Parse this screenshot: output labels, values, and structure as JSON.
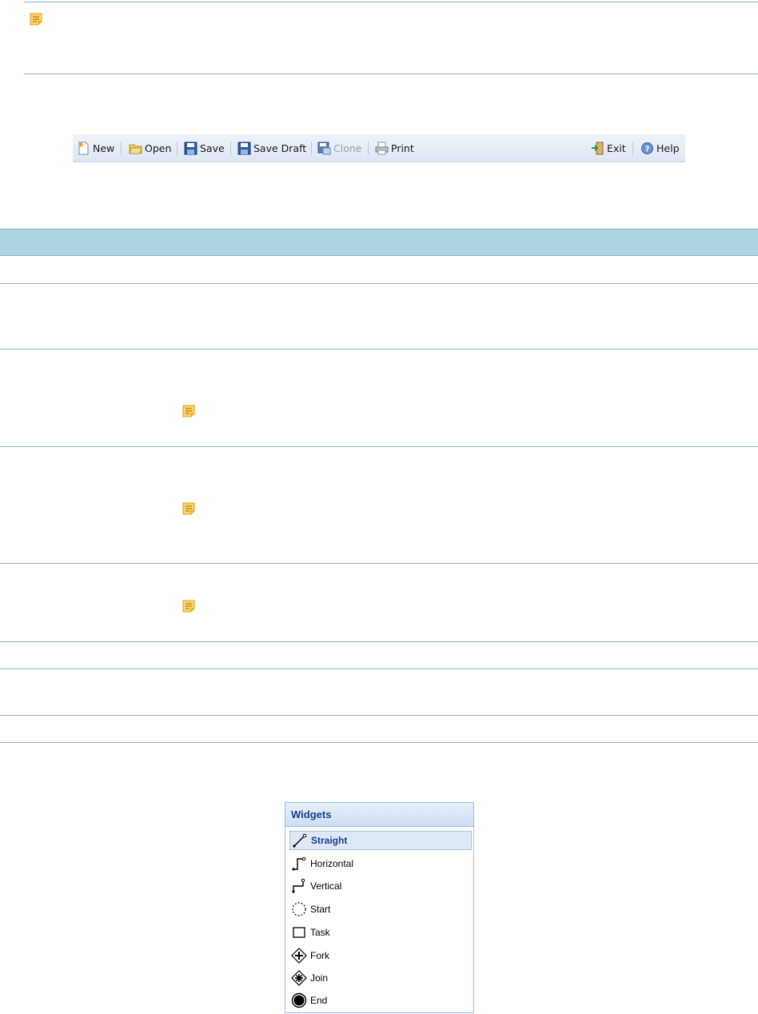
{
  "toolbar": {
    "new": "New",
    "open": "Open",
    "save": "Save",
    "save_draft": "Save Draft",
    "clone": "Clone",
    "print": "Print",
    "exit": "Exit",
    "help": "Help"
  },
  "widgets": {
    "title": "Widgets",
    "items": [
      {
        "label": "Straight",
        "icon": "straight-line-icon",
        "selected": true
      },
      {
        "label": "Horizontal",
        "icon": "horizontal-connector-icon"
      },
      {
        "label": "Vertical",
        "icon": "vertical-connector-icon"
      },
      {
        "label": "Start",
        "icon": "dashed-circle-icon"
      },
      {
        "label": "Task",
        "icon": "square-icon"
      },
      {
        "label": "Fork",
        "icon": "fork-diamond-icon"
      },
      {
        "label": "Join",
        "icon": "join-diamond-icon"
      },
      {
        "label": "End",
        "icon": "filled-circle-icon"
      }
    ]
  },
  "colors": {
    "rule": "#8ab4c8",
    "table_header": "#acd5e2",
    "note": "#f5b93a",
    "widgets_title": "#15428b"
  }
}
